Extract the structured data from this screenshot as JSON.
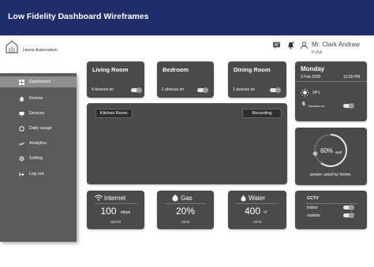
{
  "banner": {
    "title": "Low Fidelity Dashboard Wireframes"
  },
  "app": {
    "name": "Home Automation"
  },
  "header": {
    "icons": [
      "chat-icon",
      "bell-icon",
      "user-icon"
    ],
    "user_name": "Mr. Clark Andraw",
    "user_location": "PUNE"
  },
  "sidebar": {
    "items": [
      {
        "label": "Dashboard",
        "icon": "grid-icon",
        "active": true
      },
      {
        "label": "Rooms",
        "icon": "home-icon"
      },
      {
        "label": "Devices",
        "icon": "monitor-icon"
      },
      {
        "label": "Daily usage",
        "icon": "clock-icon"
      },
      {
        "label": "Analytics",
        "icon": "trend-icon"
      },
      {
        "label": "Setting",
        "icon": "gear-icon"
      },
      {
        "label": "Log out",
        "icon": "logout-icon"
      }
    ]
  },
  "rooms": [
    {
      "title": "Living Room",
      "devices": "4 devices on"
    },
    {
      "title": "Bedroom",
      "devices": "1 devices on"
    },
    {
      "title": "Dining Room",
      "devices": "1 devices on"
    }
  ],
  "camera": {
    "room_label": "Kitchen Room",
    "recording_label": "Recording"
  },
  "weather": {
    "day": "Monday",
    "date": "3 Feb 2020",
    "time": "12:00 PM",
    "temperature": "24°c",
    "devices_count": "6",
    "devices_label": "Devices on"
  },
  "power": {
    "percent": "60%",
    "unit": "watt",
    "value_fraction": 0.6,
    "caption": "power used by home."
  },
  "utilities": [
    {
      "name": "Internet",
      "value": "100",
      "unit": "mbps",
      "label": "Speed",
      "icon": "wifi-icon"
    },
    {
      "name": "Gas",
      "value": "20%",
      "unit": "",
      "label": "Used",
      "icon": "flame-icon"
    },
    {
      "name": "Water",
      "value": "400",
      "unit": "cf",
      "label": "Used",
      "icon": "drop-icon"
    }
  ],
  "cctv": {
    "title": "CCTV",
    "items": [
      {
        "label": "indoor"
      },
      {
        "label": "outdoor"
      }
    ]
  },
  "colors": {
    "banner": "#1e2e6b",
    "card": "#4a4a4a",
    "sidebar": "#5a5a5a"
  }
}
